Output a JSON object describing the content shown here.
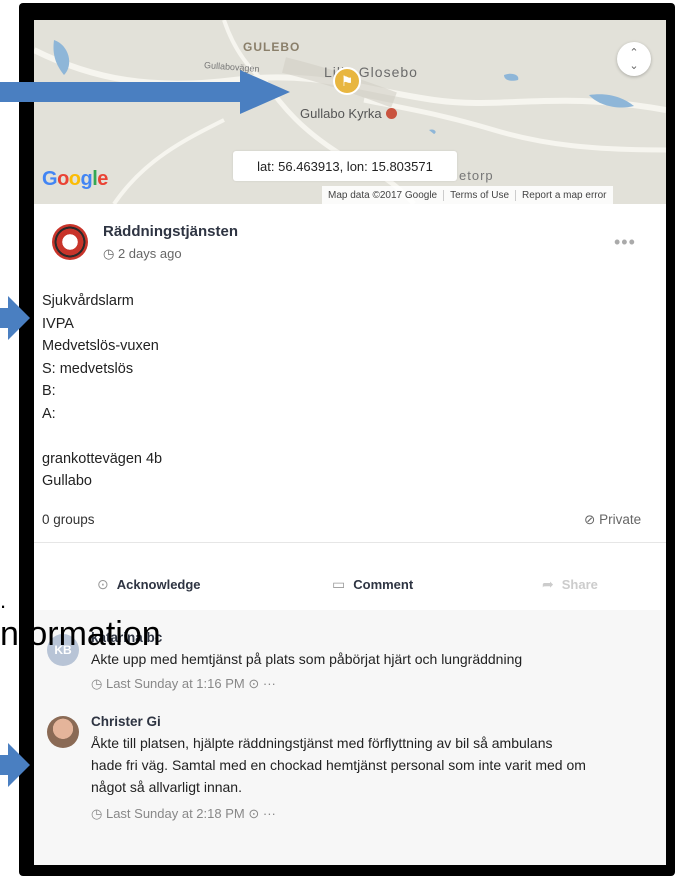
{
  "map": {
    "place_gulebo": "GULEBO",
    "road_name": "Gullabovägen",
    "place_glosebo": "Lilla Glosebo",
    "place_kyrka": "Gullabo Kyrka",
    "place_torp": "etorp",
    "coordinates": "lat: 56.463913, lon: 15.803571",
    "google_letters": [
      "G",
      "o",
      "o",
      "g",
      "l",
      "e"
    ],
    "map_data": "Map data ©2017 Google",
    "terms": "Terms of Use",
    "report": "Report a map error",
    "zoom_icon": "updown-chevron-icon"
  },
  "post": {
    "author": "Räddningstjänsten",
    "time": "2 days ago",
    "more": "•••",
    "lines": [
      "Sjukvårdslarm",
      "IVPA",
      "Medvetslös-vuxen",
      "S: medvetslös",
      "B:",
      "A:",
      "",
      "grankottevägen 4b",
      "Gullabo"
    ],
    "groups": "0 groups",
    "visibility": "Private",
    "actions": {
      "acknowledge": "Acknowledge",
      "comment": "Comment",
      "share": "Share"
    }
  },
  "comments": [
    {
      "initials": "KB",
      "name": "katarina bc",
      "text": [
        "Akte upp med hemtjänst på plats som påbörjat hjärt och lungräddning"
      ],
      "time": "Last Sunday at 1:16 PM",
      "extra": "···"
    },
    {
      "name": "Christer Gi",
      "text": [
        "Åkte till platsen, hjälpte räddningstjänst med förflyttning av bil så ambulans",
        "hade fri väg. Samtal med en chockad hemtjänst personal som inte varit med om",
        "något så allvarligt innan."
      ],
      "time": "Last Sunday at 2:18 PM",
      "extra": "···"
    }
  ],
  "overlay": {
    "partial_word": "nformation",
    "partial_char": "."
  },
  "colors": {
    "arrow": "#4a7fc1",
    "pin": "#e8b640",
    "text_dark": "#2e3442"
  }
}
